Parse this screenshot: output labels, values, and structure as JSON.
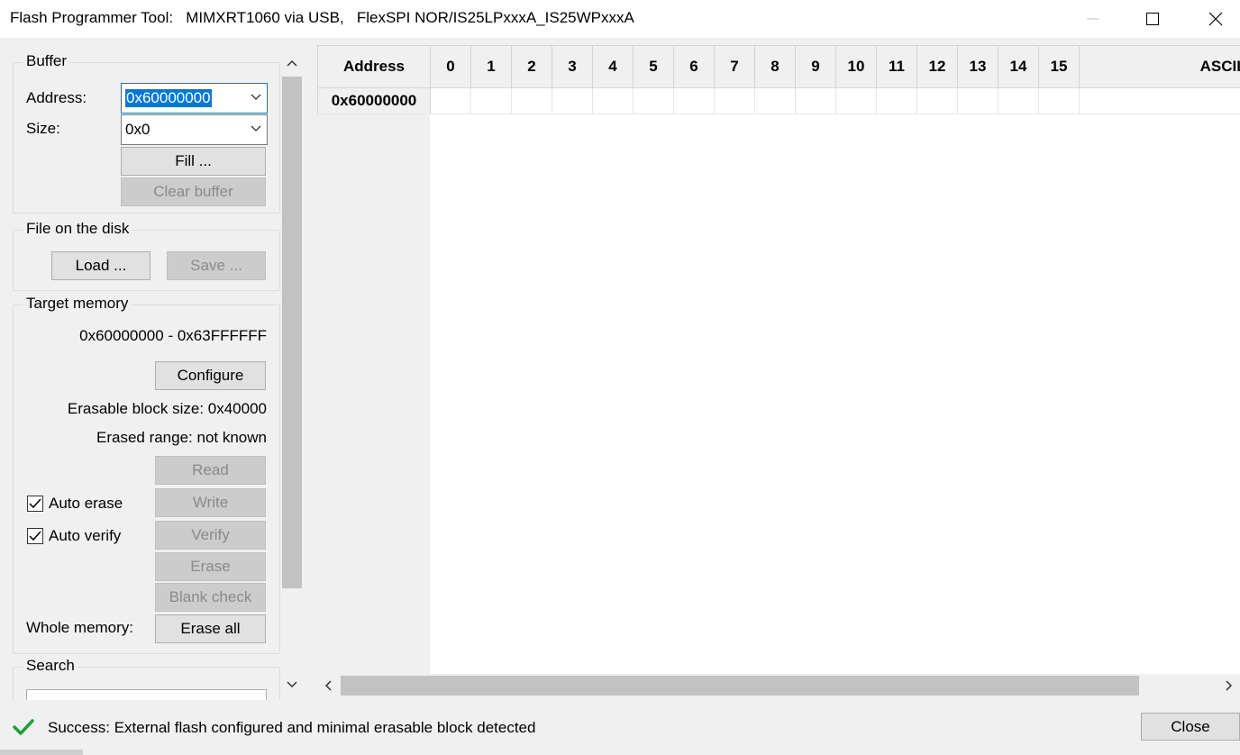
{
  "window": {
    "title": "Flash Programmer Tool:   MIMXRT1060 via USB,   FlexSPI NOR/IS25LPxxxA_IS25WPxxxA"
  },
  "buffer": {
    "legend": "Buffer",
    "address_label": "Address:",
    "address_value": "0x60000000",
    "size_label": "Size:",
    "size_value": "0x0",
    "fill_label": "Fill ...",
    "clear_label": "Clear buffer"
  },
  "file": {
    "legend": "File on the disk",
    "load_label": "Load ...",
    "save_label": "Save ..."
  },
  "target": {
    "legend": "Target memory",
    "range": "0x60000000 - 0x63FFFFFF",
    "configure_label": "Configure",
    "erasable_block": "Erasable block size: 0x40000",
    "erased_range": "Erased range: not known",
    "read_label": "Read",
    "write_label": "Write",
    "verify_label": "Verify",
    "erase_label": "Erase",
    "blank_check_label": "Blank check",
    "auto_erase_label": "Auto erase",
    "auto_erase_checked": true,
    "auto_verify_label": "Auto verify",
    "auto_verify_checked": true,
    "whole_memory_label": "Whole memory:",
    "erase_all_label": "Erase all"
  },
  "search": {
    "legend": "Search"
  },
  "grid": {
    "address_header": "Address",
    "columns": [
      "0",
      "1",
      "2",
      "3",
      "4",
      "5",
      "6",
      "7",
      "8",
      "9",
      "10",
      "11",
      "12",
      "13",
      "14",
      "15"
    ],
    "ascii_header": "ASCII",
    "rows": [
      {
        "address": "0x60000000"
      }
    ]
  },
  "status": {
    "icon": "check-icon",
    "text": "Success: External flash configured and minimal erasable block detected",
    "close_label": "Close",
    "accent": "#1e9e3c"
  }
}
